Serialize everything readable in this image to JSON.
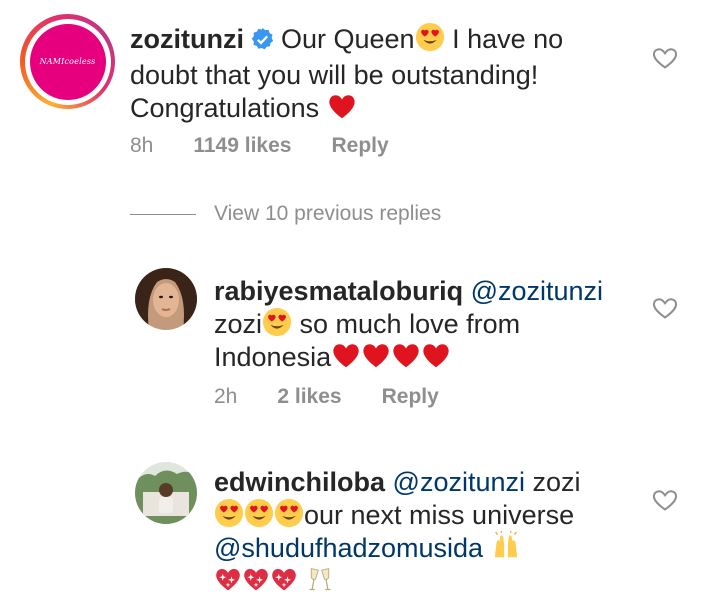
{
  "comments": [
    {
      "username": "zozitunzi",
      "verified": true,
      "text_parts": [
        "Our Queen",
        "I have no",
        "doubt that you will be outstanding!",
        "Congratulations"
      ],
      "time": "8h",
      "likes": "1149 likes",
      "reply": "Reply",
      "avatar_text": "NAMIcoeless"
    },
    {
      "username": "rabiyesmataloburiq",
      "mention": "@zozitunzi",
      "text_parts": [
        "zozi",
        "so much love from",
        "Indonesia"
      ],
      "time": "2h",
      "likes": "2 likes",
      "reply": "Reply"
    },
    {
      "username": "edwinchiloba",
      "mention": "@zozitunzi",
      "text_parts": [
        "zozi",
        "our next miss universe"
      ],
      "mention2": "@shudufhadzomusida"
    }
  ],
  "view_replies": "View 10 previous replies",
  "colors": {
    "username": "#262626",
    "muted": "#8e8e8e",
    "mention": "#00376b",
    "heart": "#e0141e",
    "verified": "#3897f0"
  },
  "icons": [
    "verified-badge-icon",
    "heart-eyes-emoji",
    "red-heart-emoji",
    "raising-hands-emoji",
    "sparkling-heart-emoji",
    "champagne-glasses-emoji",
    "like-heart-icon"
  ]
}
